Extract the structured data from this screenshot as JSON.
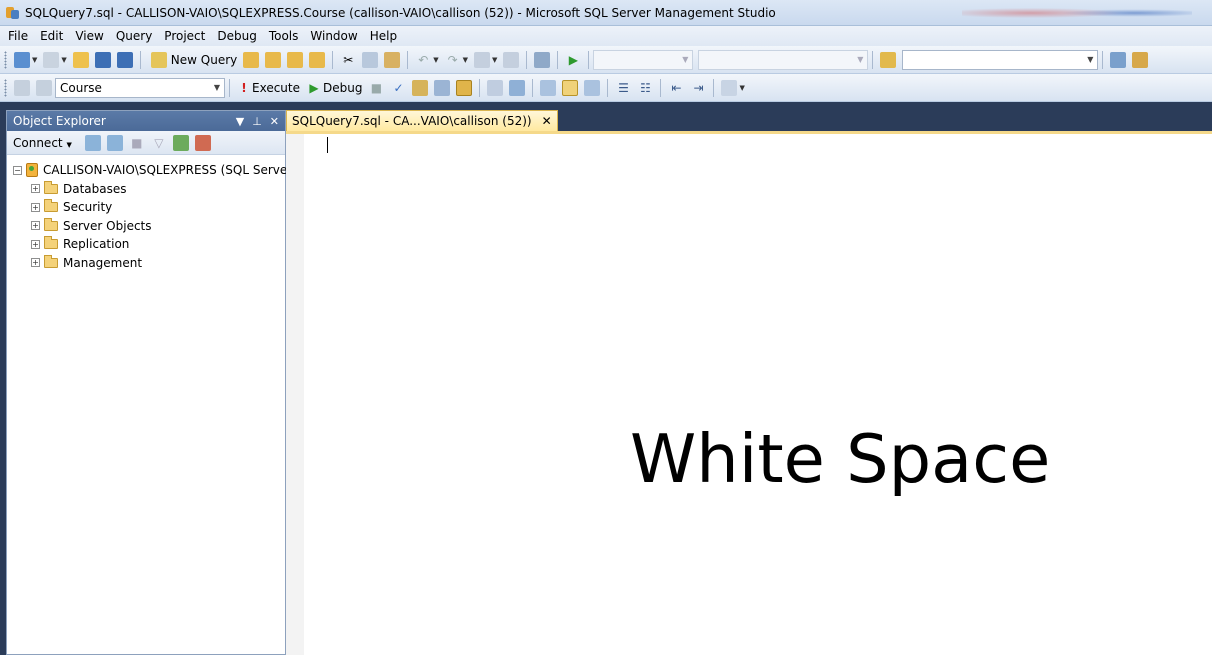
{
  "window": {
    "title": "SQLQuery7.sql - CALLISON-VAIO\\SQLEXPRESS.Course (callison-VAIO\\callison (52)) - Microsoft SQL Server Management Studio"
  },
  "menu": [
    "File",
    "Edit",
    "View",
    "Query",
    "Project",
    "Debug",
    "Tools",
    "Window",
    "Help"
  ],
  "toolbar": {
    "new_query_label": "New Query",
    "database_combo": "Course",
    "execute_label": "Execute",
    "debug_label": "Debug"
  },
  "object_explorer": {
    "title": "Object Explorer",
    "connect_label": "Connect",
    "server": "CALLISON-VAIO\\SQLEXPRESS (SQL Serve",
    "nodes": [
      "Databases",
      "Security",
      "Server Objects",
      "Replication",
      "Management"
    ]
  },
  "document": {
    "tab_label": "SQLQuery7.sql - CA...VAIO\\callison (52))",
    "overlay_text": "White Space"
  },
  "colors": {
    "frame": "#2b3c59",
    "tab_active": "#ffe9a0",
    "oe_header": "#4b6a98"
  }
}
